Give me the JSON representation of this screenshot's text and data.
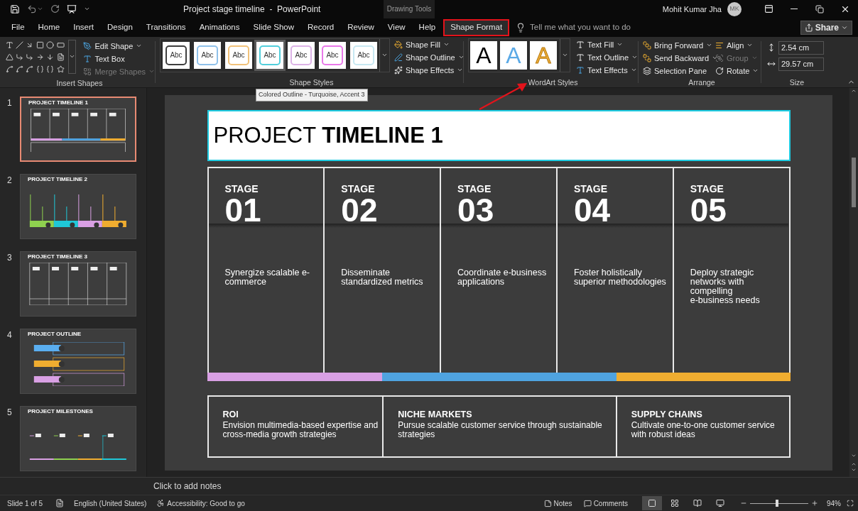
{
  "title_bar": {
    "title": "Project stage timeline  -  PowerPoint",
    "context_label": "Drawing Tools",
    "user": "Mohit Kumar Jha",
    "avatar": "MK"
  },
  "tabs": [
    {
      "label": "File",
      "selected": false
    },
    {
      "label": "Home",
      "selected": false
    },
    {
      "label": "Insert",
      "selected": false
    },
    {
      "label": "Design",
      "selected": false
    },
    {
      "label": "Transitions",
      "selected": false
    },
    {
      "label": "Animations",
      "selected": false
    },
    {
      "label": "Slide Show",
      "selected": false
    },
    {
      "label": "Record",
      "selected": false
    },
    {
      "label": "Review",
      "selected": false
    },
    {
      "label": "View",
      "selected": false
    },
    {
      "label": "Help",
      "selected": false
    },
    {
      "label": "Shape Format",
      "selected": true
    }
  ],
  "tell_me": {
    "placeholder": "Tell me what you want to do"
  },
  "share": "Share",
  "ribbon": {
    "insert_shapes": {
      "label": "Insert Shapes",
      "commands": [
        {
          "label": "Edit Shape",
          "disabled": false
        },
        {
          "label": "Text Box",
          "disabled": false
        },
        {
          "label": "Merge Shapes",
          "disabled": true
        }
      ]
    },
    "shape_styles": {
      "label": "Shape Styles",
      "styles": [
        {
          "text": "Abc",
          "color": "#3f3f3f",
          "selected": false
        },
        {
          "text": "Abc",
          "color": "#8fc1ea",
          "selected": false
        },
        {
          "text": "Abc",
          "color": "#f1c27a",
          "selected": false
        },
        {
          "text": "Abc",
          "color": "#52cfdc",
          "selected": true
        },
        {
          "text": "Abc",
          "color": "#dcb3e6",
          "selected": false
        },
        {
          "text": "Abc",
          "color": "#e979e9",
          "selected": false
        },
        {
          "text": "Abc",
          "color": "#c7e8f2",
          "selected": false
        }
      ],
      "commands": [
        {
          "label": "Shape Fill"
        },
        {
          "label": "Shape Outline"
        },
        {
          "label": "Shape Effects"
        }
      ]
    },
    "wordart_styles": {
      "label": "WordArt Styles",
      "styles": [
        {
          "text": "A",
          "kind": "filled",
          "color": "#000000"
        },
        {
          "text": "A",
          "kind": "filled",
          "color": "#5aa9e6"
        },
        {
          "text": "A",
          "kind": "outlined",
          "color": "#efb03a"
        }
      ],
      "commands": [
        {
          "label": "Text Fill"
        },
        {
          "label": "Text Outline"
        },
        {
          "label": "Text Effects"
        }
      ]
    },
    "arrange": {
      "label": "Arrange",
      "commands": [
        {
          "label": "Bring Forward",
          "disabled": false
        },
        {
          "label": "Send Backward",
          "disabled": false
        },
        {
          "label": "Selection Pane",
          "disabled": false
        },
        {
          "label": "Align",
          "disabled": false
        },
        {
          "label": "Group",
          "disabled": true
        },
        {
          "label": "Rotate",
          "disabled": false
        }
      ]
    },
    "size": {
      "label": "Size",
      "height": "2.54 cm",
      "width": "29.57 cm"
    }
  },
  "tooltip": "Colored Outline - Turquoise, Accent 3",
  "thumbnails": [
    {
      "number": "1",
      "title": "PROJECT TIMELINE 1",
      "kind": "grid",
      "selected": true
    },
    {
      "number": "2",
      "title": "PROJECT TIMELINE 2",
      "kind": "pins",
      "selected": false
    },
    {
      "number": "3",
      "title": "PROJECT TIMELINE 3",
      "kind": "grid-icons",
      "selected": false
    },
    {
      "number": "4",
      "title": "PROJECT OUTLINE",
      "kind": "outline",
      "selected": false
    },
    {
      "number": "5",
      "title": "PROJECT MILESTONES",
      "kind": "milestones",
      "selected": false
    }
  ],
  "slide": {
    "title": "PROJECT **TIMELINE 1**",
    "stages": [
      {
        "label": "STAGE",
        "number": "01",
        "text": "Synergize scalable e-\ncommerce"
      },
      {
        "label": "STAGE",
        "number": "02",
        "text": "Disseminate\nstandardized metrics"
      },
      {
        "label": "STAGE",
        "number": "03",
        "text": "Coordinate e-business\napplications"
      },
      {
        "label": "STAGE",
        "number": "04",
        "text": "Foster holistically\nsuperior methodologies"
      },
      {
        "label": "STAGE",
        "number": "05",
        "text": "Deploy strategic\nnetworks with\ncompelling\ne-business needs"
      }
    ],
    "bar_segments": [
      {
        "color": "#d9a0e4"
      },
      {
        "color": "#4fa3e0"
      },
      {
        "color": "#f0ad30"
      }
    ],
    "boxes": [
      {
        "heading": "ROI",
        "text": "Envision multimedia-based expertise and\ncross-media growth strategies"
      },
      {
        "heading": "NICHE MARKETS",
        "text": "Pursue scalable customer service through sustainable\nstrategies"
      },
      {
        "heading": "SUPPLY CHAINS",
        "text": "Cultivate one-to-one customer service\nwith robust ideas"
      }
    ]
  },
  "notes": {
    "placeholder": "Click to add notes"
  },
  "status_bar": {
    "slide": "Slide 1 of 5",
    "language": "English (United States)",
    "accessibility": "Accessibility: Good to go",
    "notes": "Notes",
    "comments": "Comments",
    "views": [
      {
        "kind": "normal",
        "selected": true
      },
      {
        "kind": "sorter",
        "selected": false
      },
      {
        "kind": "reading",
        "selected": false
      },
      {
        "kind": "slideshow",
        "selected": false
      }
    ],
    "zoom": {
      "level": 0.46,
      "reading": "94%"
    }
  }
}
